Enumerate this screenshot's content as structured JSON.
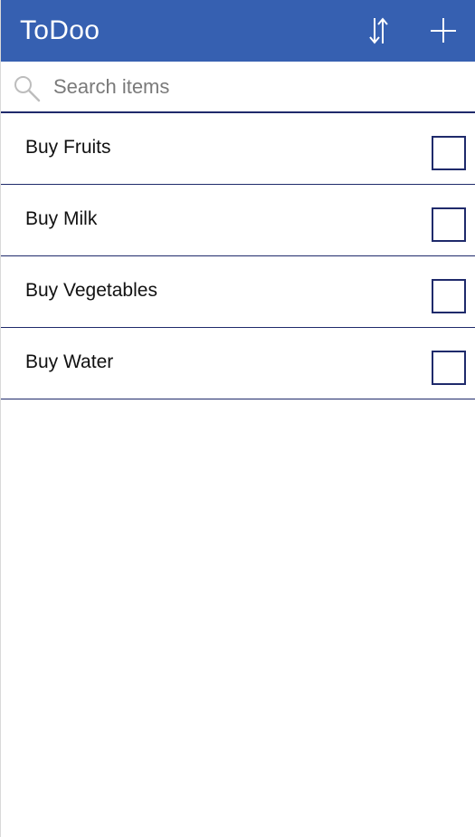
{
  "app": {
    "title": "ToDoo"
  },
  "header": {
    "sort_icon": "sort-up-down-icon",
    "add_icon": "plus-icon"
  },
  "search": {
    "placeholder": "Search items",
    "value": "",
    "icon": "search-icon"
  },
  "items": [
    {
      "label": "Buy Fruits",
      "checked": false
    },
    {
      "label": "Buy Milk",
      "checked": false
    },
    {
      "label": "Buy Vegetables",
      "checked": false
    },
    {
      "label": "Buy Water",
      "checked": false
    }
  ],
  "colors": {
    "header_bg": "#3660b1",
    "divider": "#1f2a6b",
    "checkbox_border": "#1f2a6b"
  }
}
